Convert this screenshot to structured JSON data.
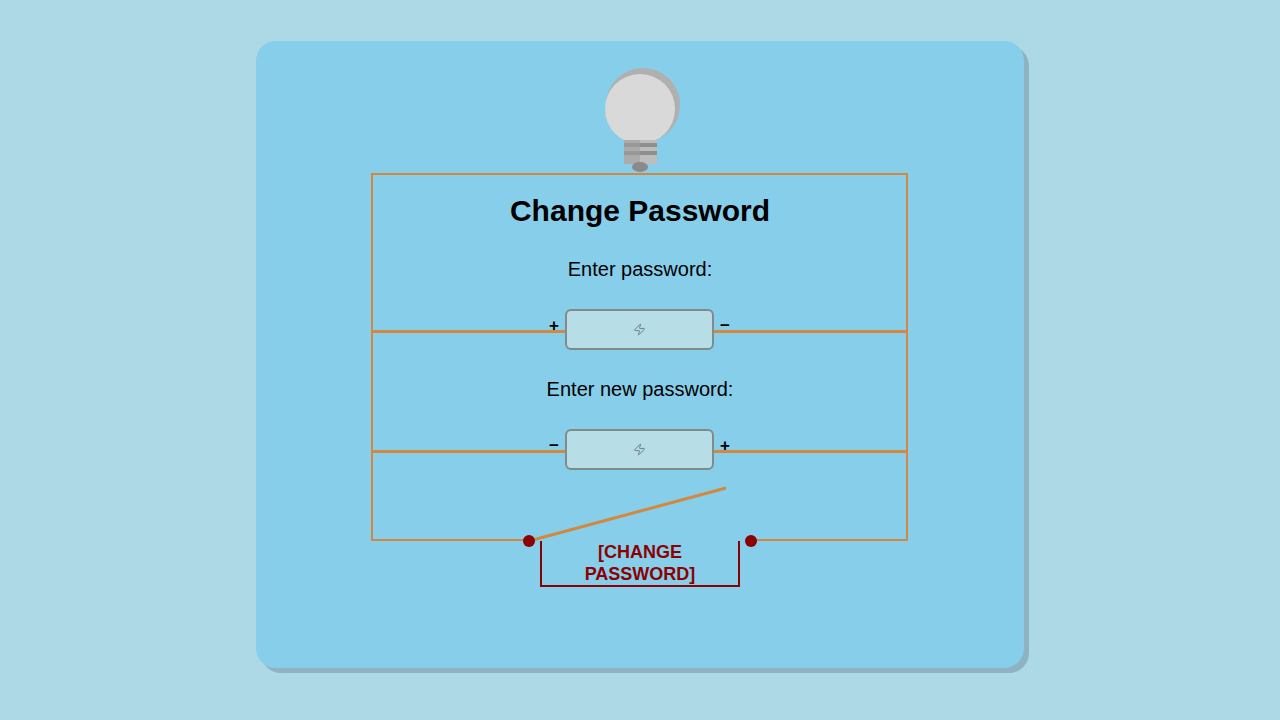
{
  "title": "Change Password",
  "fields": [
    {
      "label": "Enter password:",
      "left_sign": "+",
      "right_sign": "−",
      "value": ""
    },
    {
      "label": "Enter new password:",
      "left_sign": "−",
      "right_sign": "+",
      "value": ""
    }
  ],
  "switch": {
    "closed": false
  },
  "bulb": {
    "lit": false
  },
  "button": "[CHANGE PASSWORD]"
}
